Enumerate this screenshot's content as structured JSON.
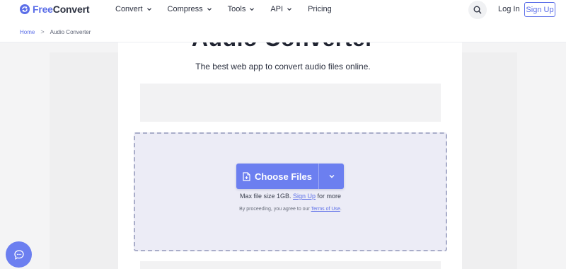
{
  "brand": {
    "name_part1": "Free",
    "name_part2": "Convert",
    "accent": "#5b6ee8"
  },
  "nav": {
    "items": [
      {
        "label": "Convert",
        "has_dropdown": true
      },
      {
        "label": "Compress",
        "has_dropdown": true
      },
      {
        "label": "Tools",
        "has_dropdown": true
      },
      {
        "label": "API",
        "has_dropdown": true
      },
      {
        "label": "Pricing",
        "has_dropdown": false
      }
    ],
    "search_icon": "search-icon",
    "login_label": "Log In",
    "signup_label": "Sign Up"
  },
  "breadcrumb": {
    "home": "Home",
    "separator": ">",
    "current": "Audio Converter"
  },
  "main": {
    "title": "Audio Converter",
    "subtitle": "The best web app to convert audio files online.",
    "choose_files_label": "Choose Files",
    "max_size_prefix": "Max file size 1GB.",
    "max_size_link": "Sign Up",
    "max_size_suffix": "for more",
    "terms_prefix": "By proceeding, you agree to our",
    "terms_link": "Terms of Use",
    "terms_suffix": "."
  },
  "colors": {
    "primary_button": "#6c7ff0",
    "dropzone_bg": "#ececf6",
    "dropzone_border": "#a9adc9"
  }
}
